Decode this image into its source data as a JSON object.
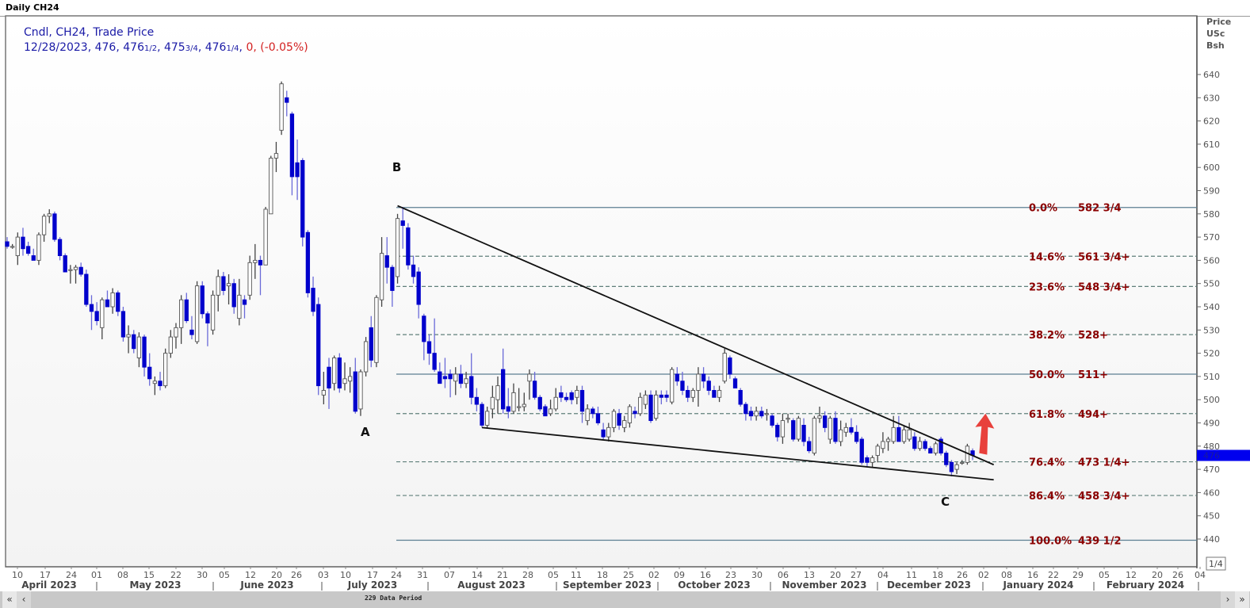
{
  "window": {
    "title": "Daily CH24"
  },
  "legend": {
    "line1": "Cndl, CH24, Trade Price",
    "date": "12/28/2023",
    "open": "476",
    "high": "476",
    "high_frac": "1/2",
    "low": "475",
    "low_frac": "3/4",
    "close": "476",
    "close_frac": "1/4",
    "change": "0, (-0.05%)"
  },
  "axis": {
    "unit_lines": [
      "Price",
      "USc",
      "Bsh"
    ],
    "current_price_label": "476",
    "scale_box": "1/4"
  },
  "scrollbar": {
    "period_label": "229 Data Period",
    "first": "«",
    "prev": "‹",
    "next": "›",
    "last": "»"
  },
  "colors": {
    "down_candle": "#0000cc",
    "up_candle": "#ffffff",
    "fib_text": "#8b0000",
    "arrow": "#e8413c",
    "current_price": "#0000ee"
  },
  "chart_data": {
    "type": "candlestick",
    "title": "Daily CH24",
    "ylabel": "Price USc Bsh",
    "ylim": [
      435,
      648
    ],
    "yticks": [
      440,
      450,
      460,
      470,
      480,
      490,
      500,
      510,
      520,
      530,
      540,
      550,
      560,
      570,
      580,
      590,
      600,
      610,
      620,
      630,
      640
    ],
    "grid": false,
    "xticks_days": [
      "10",
      "17",
      "24",
      "01",
      "08",
      "15",
      "22",
      "30",
      "05",
      "12",
      "20",
      "26",
      "03",
      "10",
      "17",
      "24",
      "31",
      "07",
      "14",
      "21",
      "28",
      "05",
      "11",
      "18",
      "25",
      "02",
      "09",
      "16",
      "23",
      "30",
      "06",
      "13",
      "20",
      "27",
      "04",
      "11",
      "18",
      "26",
      "02",
      "08",
      "16",
      "22",
      "29",
      "05",
      "12",
      "20",
      "26",
      "04"
    ],
    "xticks_months": [
      "April 2023",
      "May 2023",
      "June 2023",
      "July 2023",
      "August 2023",
      "September 2023",
      "October 2023",
      "November 2023",
      "December 2023",
      "January 2024",
      "February 2024"
    ],
    "ohlc_fields": [
      "open",
      "high",
      "low",
      "close"
    ],
    "candles": [
      [
        568,
        570,
        565,
        566
      ],
      [
        566,
        567,
        565,
        566
      ],
      [
        562,
        572,
        558,
        570
      ],
      [
        570,
        574,
        562,
        565
      ],
      [
        566,
        568,
        562,
        563
      ],
      [
        562,
        565,
        560,
        560
      ],
      [
        560,
        572,
        558,
        571
      ],
      [
        571,
        580,
        568,
        579
      ],
      [
        579,
        582,
        576,
        580
      ],
      [
        580,
        581,
        568,
        569
      ],
      [
        569,
        570,
        560,
        562
      ],
      [
        562,
        563,
        555,
        555
      ],
      [
        556,
        558,
        550,
        556
      ],
      [
        556,
        558,
        550,
        557
      ],
      [
        557,
        559,
        553,
        554
      ],
      [
        554,
        556,
        540,
        541
      ],
      [
        541,
        545,
        530,
        538
      ],
      [
        538,
        542,
        532,
        534
      ],
      [
        531,
        544,
        526,
        543
      ],
      [
        543,
        547,
        540,
        540
      ],
      [
        540,
        548,
        537,
        546
      ],
      [
        546,
        547,
        536,
        538
      ],
      [
        538,
        540,
        525,
        527
      ],
      [
        527,
        532,
        520,
        528
      ],
      [
        528,
        530,
        520,
        522
      ],
      [
        518,
        529,
        514,
        527
      ],
      [
        527,
        528,
        510,
        514
      ],
      [
        514,
        520,
        506,
        509
      ],
      [
        507,
        510,
        502,
        508
      ],
      [
        508,
        512,
        504,
        506
      ],
      [
        506,
        522,
        505,
        520
      ],
      [
        520,
        530,
        518,
        527
      ],
      [
        527,
        533,
        522,
        531
      ],
      [
        531,
        545,
        524,
        543
      ],
      [
        543,
        546,
        533,
        534
      ],
      [
        530,
        536,
        526,
        528
      ],
      [
        525,
        551,
        524,
        549
      ],
      [
        549,
        551,
        535,
        537
      ],
      [
        537,
        538,
        523,
        533
      ],
      [
        530,
        547,
        528,
        545
      ],
      [
        545,
        556,
        538,
        553
      ],
      [
        553,
        555,
        545,
        547
      ],
      [
        549,
        554,
        541,
        550
      ],
      [
        550,
        552,
        537,
        540
      ],
      [
        535,
        552,
        532,
        545
      ],
      [
        543,
        545,
        535,
        541
      ],
      [
        545,
        562,
        543,
        559
      ],
      [
        559,
        567,
        552,
        560
      ],
      [
        560,
        562,
        545,
        558
      ],
      [
        558,
        583,
        558,
        582
      ],
      [
        580,
        605,
        580,
        604
      ],
      [
        604,
        611,
        598,
        606
      ],
      [
        616,
        637,
        614,
        636
      ],
      [
        630,
        633,
        622,
        628
      ],
      [
        623,
        624,
        588,
        596
      ],
      [
        602,
        612,
        586,
        596
      ],
      [
        603,
        604,
        566,
        570
      ],
      [
        572,
        573,
        544,
        546
      ],
      [
        548,
        553,
        536,
        538
      ],
      [
        541,
        544,
        502,
        506
      ],
      [
        502,
        512,
        498,
        504
      ],
      [
        514,
        518,
        496,
        505
      ],
      [
        507,
        519,
        504,
        518
      ],
      [
        518,
        520,
        503,
        505
      ],
      [
        507,
        516,
        504,
        509
      ],
      [
        508,
        514,
        503,
        510
      ],
      [
        512,
        518,
        494,
        495
      ],
      [
        496,
        513,
        493,
        512
      ],
      [
        512,
        527,
        510,
        525
      ],
      [
        531,
        536,
        514,
        517
      ],
      [
        516,
        545,
        514,
        544
      ],
      [
        543,
        570,
        540,
        563
      ],
      [
        562,
        570,
        550,
        557
      ],
      [
        557,
        558,
        540,
        547
      ],
      [
        553,
        580,
        550,
        578
      ],
      [
        577,
        583,
        565,
        575
      ],
      [
        574,
        576,
        556,
        558
      ],
      [
        558,
        562,
        550,
        553
      ],
      [
        555,
        557,
        535,
        541
      ],
      [
        536,
        537,
        517,
        525
      ],
      [
        525,
        528,
        515,
        520
      ],
      [
        520,
        535,
        512,
        513
      ],
      [
        512,
        516,
        507,
        507
      ],
      [
        510,
        518,
        505,
        509
      ],
      [
        511,
        513,
        501,
        509
      ],
      [
        508,
        514,
        502,
        511
      ],
      [
        511,
        515,
        505,
        507
      ],
      [
        507,
        512,
        505,
        509
      ],
      [
        510,
        520,
        498,
        501
      ],
      [
        501,
        505,
        495,
        498
      ],
      [
        498,
        499,
        488,
        489
      ],
      [
        489,
        497,
        488,
        495
      ],
      [
        496,
        506,
        492,
        501
      ],
      [
        500,
        510,
        494,
        506
      ],
      [
        513,
        522,
        494,
        496
      ],
      [
        497,
        505,
        492,
        495
      ],
      [
        495,
        507,
        494,
        503
      ],
      [
        497,
        505,
        495,
        497
      ],
      [
        497,
        503,
        495,
        498
      ],
      [
        508,
        513,
        500,
        511
      ],
      [
        508,
        512,
        500,
        501
      ],
      [
        501,
        502,
        495,
        496
      ],
      [
        497,
        498,
        493,
        493
      ],
      [
        494,
        500,
        493,
        496
      ],
      [
        496,
        505,
        495,
        501
      ],
      [
        503,
        506,
        499,
        501
      ],
      [
        501,
        503,
        499,
        500
      ],
      [
        503,
        504,
        498,
        500
      ],
      [
        501,
        506,
        498,
        504
      ],
      [
        504,
        506,
        490,
        495
      ],
      [
        491,
        498,
        489,
        496
      ],
      [
        496,
        497,
        492,
        494
      ],
      [
        494,
        497,
        489,
        490
      ],
      [
        487,
        490,
        483,
        484
      ],
      [
        484,
        490,
        482,
        488
      ],
      [
        488,
        496,
        486,
        495
      ],
      [
        494,
        496,
        487,
        489
      ],
      [
        488,
        493,
        486,
        491
      ],
      [
        490,
        498,
        488,
        497
      ],
      [
        495,
        497,
        492,
        494
      ],
      [
        494,
        503,
        493,
        501
      ],
      [
        498,
        504,
        496,
        502
      ],
      [
        502,
        504,
        490,
        491
      ],
      [
        492,
        504,
        491,
        502
      ],
      [
        502,
        504,
        498,
        501
      ],
      [
        502,
        504,
        499,
        501
      ],
      [
        499,
        514,
        498,
        513
      ],
      [
        511,
        514,
        506,
        508
      ],
      [
        508,
        512,
        502,
        504
      ],
      [
        504,
        506,
        499,
        501
      ],
      [
        501,
        505,
        499,
        504
      ],
      [
        504,
        514,
        497,
        511
      ],
      [
        511,
        514,
        505,
        508
      ],
      [
        508,
        510,
        502,
        504
      ],
      [
        504,
        506,
        501,
        501
      ],
      [
        501,
        506,
        499,
        504
      ],
      [
        508,
        522,
        507,
        520
      ],
      [
        518,
        519,
        509,
        511
      ],
      [
        509,
        510,
        505,
        505
      ],
      [
        504,
        505,
        497,
        498
      ],
      [
        498,
        499,
        491,
        494
      ],
      [
        495,
        497,
        491,
        493
      ],
      [
        493,
        497,
        491,
        495
      ],
      [
        495,
        497,
        492,
        493
      ],
      [
        494,
        496,
        491,
        494
      ],
      [
        493,
        494,
        488,
        489
      ],
      [
        489,
        490,
        482,
        484
      ],
      [
        484,
        494,
        481,
        491
      ],
      [
        492,
        494,
        490,
        492
      ],
      [
        491,
        492,
        482,
        483
      ],
      [
        483,
        493,
        482,
        492
      ],
      [
        489,
        492,
        480,
        482
      ],
      [
        482,
        484,
        477,
        478
      ],
      [
        477,
        493,
        476,
        492
      ],
      [
        492,
        497,
        490,
        493
      ],
      [
        493,
        495,
        486,
        488
      ],
      [
        483,
        493,
        481,
        492
      ],
      [
        492,
        495,
        481,
        482
      ],
      [
        482,
        491,
        480,
        487
      ],
      [
        486,
        490,
        484,
        488
      ],
      [
        488,
        492,
        485,
        486
      ],
      [
        486,
        489,
        481,
        482
      ],
      [
        483,
        484,
        472,
        473
      ],
      [
        475,
        476,
        471,
        473
      ],
      [
        473,
        476,
        471,
        475
      ],
      [
        476,
        481,
        473,
        480
      ],
      [
        479,
        486,
        477,
        482
      ],
      [
        482,
        484,
        478,
        483
      ],
      [
        482,
        493,
        481,
        488
      ],
      [
        488,
        493,
        482,
        482
      ],
      [
        482,
        489,
        481,
        487
      ],
      [
        483,
        490,
        482,
        487
      ],
      [
        484,
        486,
        478,
        479
      ],
      [
        479,
        484,
        478,
        482
      ],
      [
        482,
        483,
        478,
        479
      ],
      [
        479,
        480,
        477,
        477
      ],
      [
        477,
        482,
        476,
        481
      ],
      [
        483,
        484,
        476,
        477
      ],
      [
        477,
        478,
        471,
        472
      ],
      [
        473,
        474,
        467,
        469
      ],
      [
        470,
        473,
        468,
        472
      ],
      [
        473,
        474,
        472,
        473
      ],
      [
        473,
        481,
        472,
        480
      ],
      [
        478,
        479,
        474,
        476
      ]
    ],
    "fibonacci": [
      {
        "pct": "0.0%",
        "label": "582 3/4",
        "price": 582.75,
        "style": "solid"
      },
      {
        "pct": "14.6%",
        "label": "561 3/4+",
        "price": 561.75,
        "style": "dashed"
      },
      {
        "pct": "23.6%",
        "label": "548 3/4+",
        "price": 548.75,
        "style": "dashed"
      },
      {
        "pct": "38.2%",
        "label": "528+",
        "price": 528,
        "style": "dashed"
      },
      {
        "pct": "50.0%",
        "label": "511+",
        "price": 511,
        "style": "solid"
      },
      {
        "pct": "61.8%",
        "label": "494+",
        "price": 494,
        "style": "dashed"
      },
      {
        "pct": "76.4%",
        "label": "473 1/4+",
        "price": 473.25,
        "style": "dashed"
      },
      {
        "pct": "86.4%",
        "label": "458 3/4+",
        "price": 458.75,
        "style": "dashed"
      },
      {
        "pct": "100.0%",
        "label": "439 1/2",
        "price": 439.5,
        "style": "solid"
      }
    ],
    "trendlines": [
      {
        "name": "upper",
        "from": {
          "bar": 74,
          "price": 583.5
        },
        "to": {
          "bar": 187,
          "price": 472
        }
      },
      {
        "name": "lower",
        "from": {
          "bar": 90,
          "price": 488
        },
        "to": {
          "bar": 187,
          "price": 465.5
        }
      }
    ],
    "annotations": [
      {
        "text": "A",
        "bar": 67,
        "price": 486
      },
      {
        "text": "B",
        "bar": 73,
        "price": 600
      },
      {
        "text": "C",
        "bar": 177,
        "price": 456
      }
    ],
    "arrow": {
      "direction": "up",
      "bar": 185,
      "from_price": 477,
      "to_price": 494
    },
    "current_price": 476
  }
}
